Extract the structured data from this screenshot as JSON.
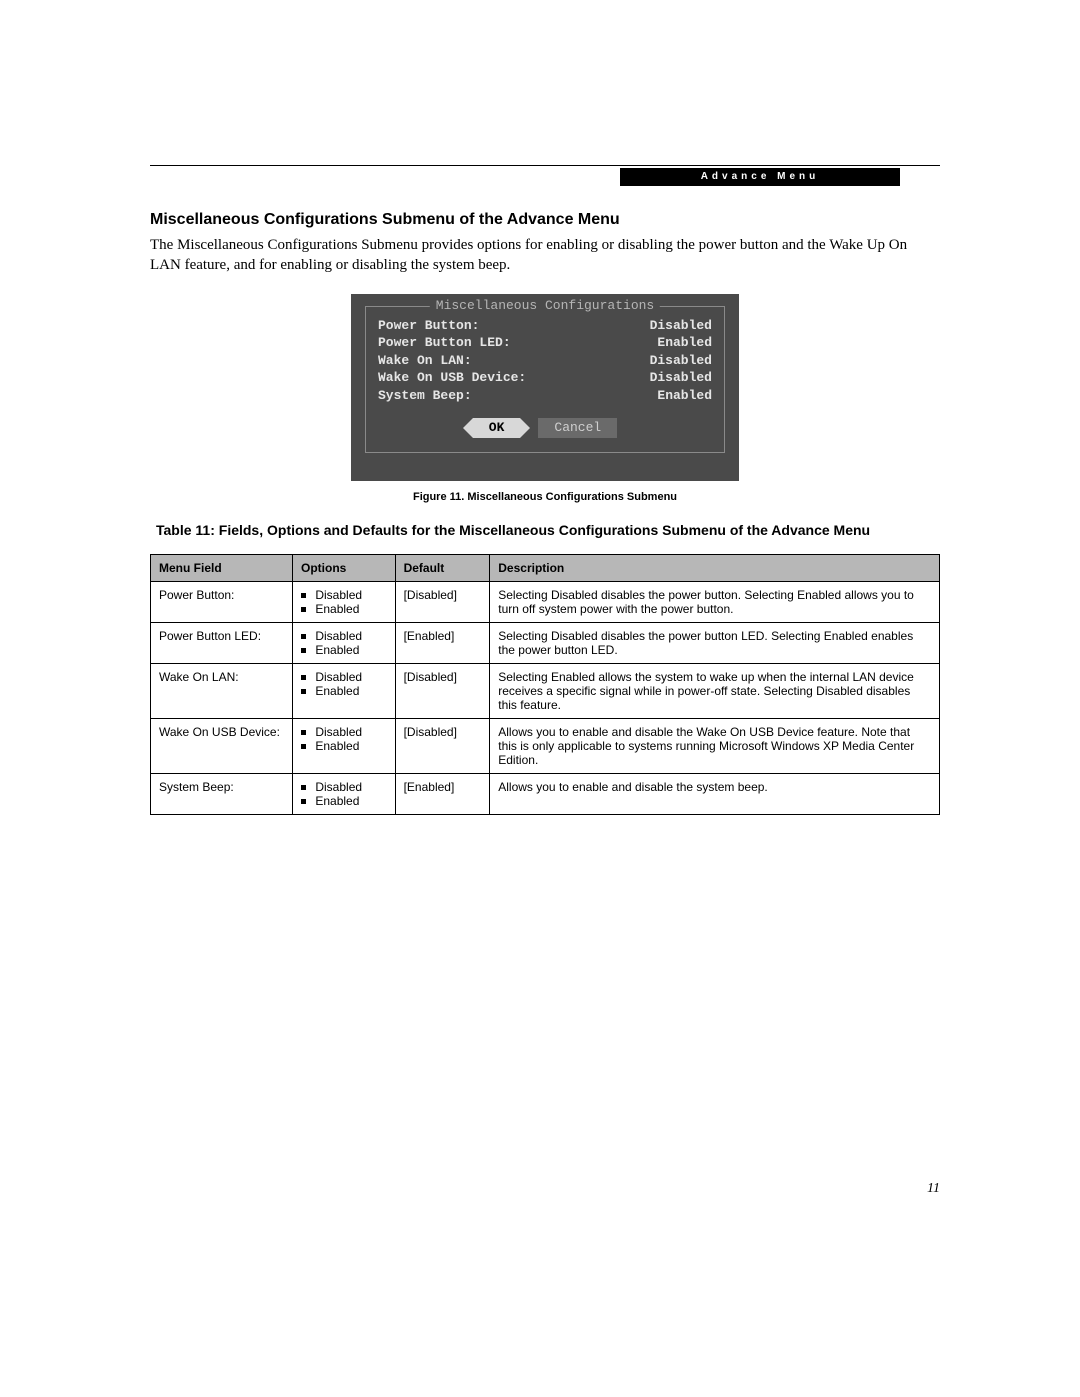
{
  "header": {
    "badge": "Advance Menu"
  },
  "section": {
    "title": "Miscellaneous Configurations Submenu of the Advance Menu",
    "paragraph": "The Miscellaneous Configurations Submenu provides options for enabling or disabling the power button and the Wake Up On LAN feature, and for enabling or disabling the system beep."
  },
  "bios": {
    "legend": "Miscellaneous Configurations",
    "rows": [
      {
        "label": "Power Button:",
        "value": "Disabled"
      },
      {
        "label": "Power Button LED:",
        "value": "Enabled"
      },
      {
        "label": "Wake On LAN:",
        "value": "Disabled"
      },
      {
        "label": "Wake On USB Device:",
        "value": "Disabled"
      },
      {
        "label": "System Beep:",
        "value": "Enabled"
      }
    ],
    "ok": "OK",
    "cancel": "Cancel"
  },
  "figure_caption": "Figure 11.  Miscellaneous Configurations Submenu",
  "table_title": "Table 11: Fields, Options and Defaults for the Miscellaneous Configurations Submenu of the Advance Menu",
  "table": {
    "headers": {
      "menu": "Menu Field",
      "options": "Options",
      "default": "Default",
      "description": "Description"
    },
    "rows": [
      {
        "menu": "Power Button:",
        "options": [
          "Disabled",
          "Enabled"
        ],
        "default": "[Disabled]",
        "description": "Selecting Disabled disables the power button. Selecting Enabled allows you to turn off system power with the power button."
      },
      {
        "menu": "Power Button LED:",
        "options": [
          "Disabled",
          "Enabled"
        ],
        "default": "[Enabled]",
        "description": "Selecting Disabled disables the power button LED. Selecting Enabled enables the power button LED."
      },
      {
        "menu": "Wake On LAN:",
        "options": [
          "Disabled",
          "Enabled"
        ],
        "default": "[Disabled]",
        "description": "Selecting Enabled allows the system to wake up when the internal LAN device receives a specific signal while in power-off state. Selecting Disabled disables this feature."
      },
      {
        "menu": "Wake On USB Device:",
        "options": [
          "Disabled",
          "Enabled"
        ],
        "default": "[Disabled]",
        "description": "Allows you to enable and disable the Wake On USB Device feature. Note that this is only applicable to systems running Microsoft Windows XP Media Center Edition."
      },
      {
        "menu": "System Beep:",
        "options": [
          "Disabled",
          "Enabled"
        ],
        "default": "[Enabled]",
        "description": "Allows you to enable and disable the system beep."
      }
    ]
  },
  "page_number": "11"
}
